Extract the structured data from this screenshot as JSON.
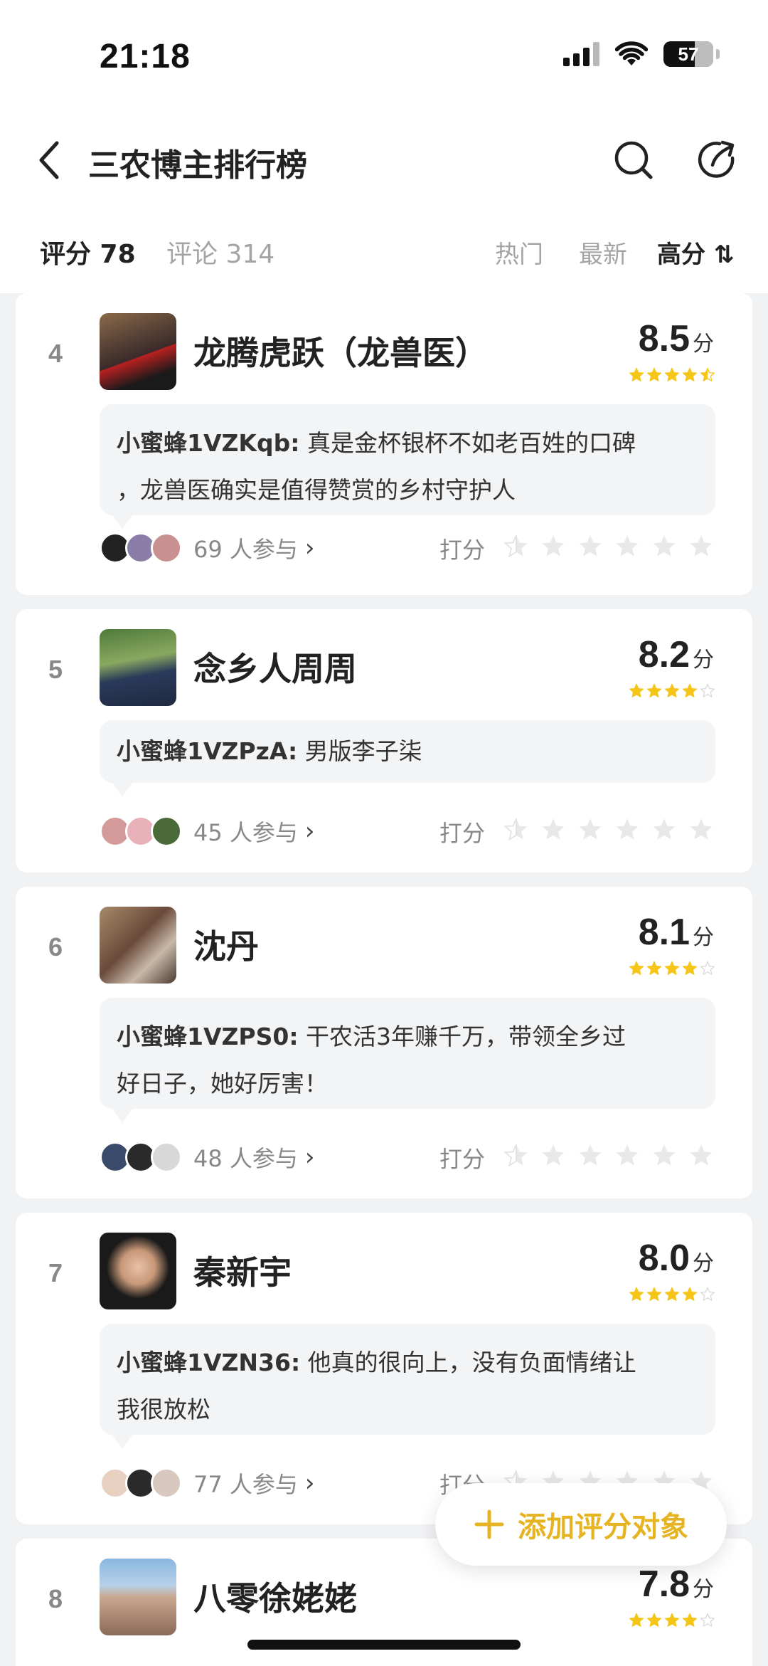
{
  "status_bar": {
    "time": "21:18",
    "battery": "57"
  },
  "nav": {
    "title": "三农博主排行榜"
  },
  "tabs": {
    "rating": "评分 78",
    "comments": "评论 314",
    "sort_hot": "热门",
    "sort_new": "最新",
    "sort_high": "高分 ⇅"
  },
  "common": {
    "rate_label": "打分",
    "score_unit": "分"
  },
  "items": [
    {
      "rank": "4",
      "name": "龙腾虎跃（龙兽医）",
      "score": "8.5",
      "stars": 4.5,
      "comment_user": "小蜜蜂1VZKqb:",
      "comment_line1": "真是金杯银杯不如老百姓的口碑",
      "comment_line2": "，龙兽医确实是值得赞赏的乡村守护人",
      "participants": "69 人参与"
    },
    {
      "rank": "5",
      "name": "念乡人周周",
      "score": "8.2",
      "stars": 4,
      "comment_user": "小蜜蜂1VZPzA:",
      "comment_line1": "男版李子柒",
      "comment_line2": "",
      "participants": "45 人参与"
    },
    {
      "rank": "6",
      "name": "沈丹",
      "score": "8.1",
      "stars": 4,
      "comment_user": "小蜜蜂1VZPS0:",
      "comment_line1": "干农活3年赚千万，带领全乡过",
      "comment_line2": "好日子，她好厉害！",
      "participants": "48 人参与"
    },
    {
      "rank": "7",
      "name": "秦新宇",
      "score": "8.0",
      "stars": 4,
      "comment_user": "小蜜蜂1VZN36:",
      "comment_line1": "他真的很向上，没有负面情绪让",
      "comment_line2": "我很放松",
      "participants": "77 人参与"
    },
    {
      "rank": "8",
      "name": "八零徐姥姥",
      "score": "7.8",
      "stars": 4
    }
  ],
  "fab": {
    "label": "添加评分对象"
  },
  "colors": {
    "accent": "#e6b422",
    "star_filled": "#f5c518",
    "star_empty": "#d9d9d9"
  }
}
